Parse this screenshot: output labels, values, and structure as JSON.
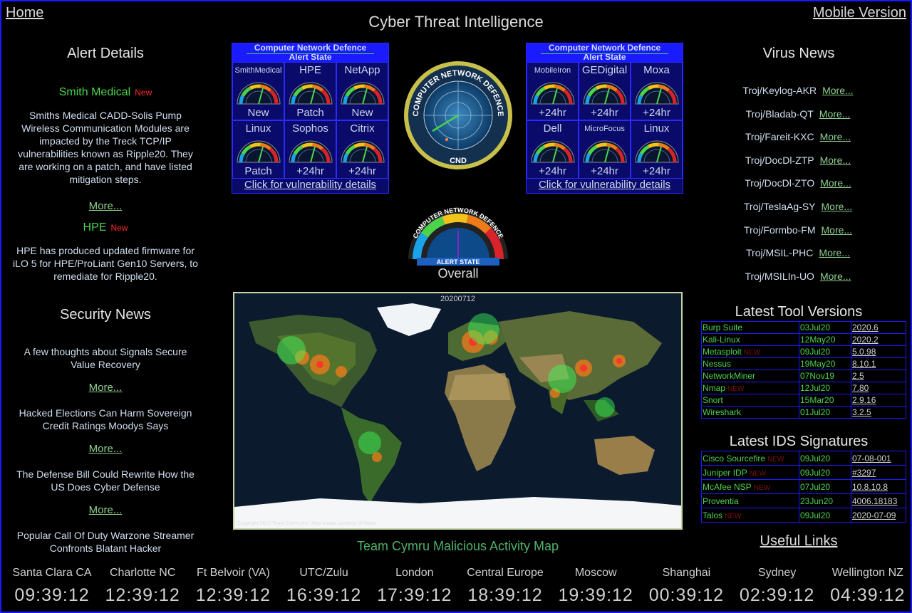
{
  "nav": {
    "home": "Home",
    "mobile": "Mobile Version"
  },
  "page_title": "Cyber Threat Intelligence",
  "alert_details": {
    "heading": "Alert Details",
    "alerts": [
      {
        "title": "Smith Medical",
        "new": "New",
        "text": "Smiths Medical CADD-Solis Pump Wireless Communication Modules are impacted by the Treck TCP/IP vulnerabilities known as Ripple20. They are working on a patch, and have listed mitigation steps.",
        "more": "More..."
      },
      {
        "title": "HPE",
        "new": "New",
        "text": "HPE has produced updated firmware for iLO 5 for HPE/ProLiant Gen10 Servers, to remediate for Ripple20.",
        "more": ""
      }
    ]
  },
  "security_news": {
    "heading": "Security News",
    "items": [
      {
        "text": "A few thoughts about Signals Secure Value Recovery",
        "more": "More..."
      },
      {
        "text": "Hacked Elections Can Harm Sovereign Credit Ratings Moodys Says",
        "more": "More..."
      },
      {
        "text": "The Defense Bill Could Rewrite How the US Does Cyber Defense",
        "more": "More..."
      },
      {
        "text": "Popular Call Of Duty Warzone Streamer Confronts Blatant Hacker",
        "more": ""
      }
    ]
  },
  "cnd_panels": [
    {
      "header": "Computer Network Defence",
      "subheader": "Alert State",
      "link": "Click for vulnerability details",
      "vendors": [
        {
          "name": "SmithMedical",
          "status": "New"
        },
        {
          "name": "HPE",
          "status": "Patch"
        },
        {
          "name": "NetApp",
          "status": "New"
        },
        {
          "name": "Linux",
          "status": "Patch"
        },
        {
          "name": "Sophos",
          "status": "+24hr"
        },
        {
          "name": "Citrix",
          "status": "+24hr"
        }
      ]
    },
    {
      "header": "Computer Network Defence",
      "subheader": "Alert State",
      "link": "Click for vulnerability details",
      "vendors": [
        {
          "name": "MobileIron",
          "status": "+24hr"
        },
        {
          "name": "GEDigital",
          "status": "+24hr"
        },
        {
          "name": "Moxa",
          "status": "+24hr"
        },
        {
          "name": "Dell",
          "status": "+24hr"
        },
        {
          "name": "MicroFocus",
          "status": "+24hr"
        },
        {
          "name": "Linux",
          "status": "+24hr"
        }
      ]
    }
  ],
  "cnd_logo": {
    "ring_top": "COMPUTER NETWORK DEFENCE",
    "bottom": "CND"
  },
  "overall": {
    "arc_text": "COMPUTER NETWORK DEFENCE",
    "badge": "ALERT STATE",
    "label": "Overall"
  },
  "map": {
    "date": "20200712",
    "copyright": "Copyright 2017 Team Cymru,Inc. Map image courtesy of Nasa.",
    "caption": "Team Cymru Malicious Activity Map"
  },
  "virus_news": {
    "heading": "Virus News",
    "items": [
      {
        "name": "Troj/Keylog-AKR",
        "more": "More..."
      },
      {
        "name": "Troj/Bladab-QT",
        "more": "More..."
      },
      {
        "name": "Troj/Fareit-KXC",
        "more": "More..."
      },
      {
        "name": "Troj/DocDl-ZTP",
        "more": "More..."
      },
      {
        "name": "Troj/DocDl-ZTO",
        "more": "More..."
      },
      {
        "name": "Troj/TeslaAg-SY",
        "more": "More..."
      },
      {
        "name": "Troj/Formbo-FM",
        "more": "More..."
      },
      {
        "name": "Troj/MSIL-PHC",
        "more": "More..."
      },
      {
        "name": "Troj/MSILIn-UO",
        "more": "More..."
      }
    ]
  },
  "tool_versions": {
    "heading": "Latest Tool Versions",
    "rows": [
      {
        "tool": "Burp Suite",
        "new": "",
        "date": "03Jul20",
        "version": "2020.6"
      },
      {
        "tool": "Kali-Linux",
        "new": "",
        "date": "12May20",
        "version": "2020.2"
      },
      {
        "tool": "Metasploit",
        "new": "NEW",
        "date": "09Jul20",
        "version": "5.0.98"
      },
      {
        "tool": "Nessus",
        "new": "",
        "date": "19May20",
        "version": "8.10.1"
      },
      {
        "tool": "NetworkMiner",
        "new": "",
        "date": "07Nov19",
        "version": "2.5"
      },
      {
        "tool": "Nmap",
        "new": "NEW",
        "date": "12Jul20",
        "version": "7.80"
      },
      {
        "tool": "Snort",
        "new": "",
        "date": "15Mar20",
        "version": "2.9.16"
      },
      {
        "tool": "Wireshark",
        "new": "",
        "date": "01Jul20",
        "version": "3.2.5"
      }
    ]
  },
  "ids_signatures": {
    "heading": "Latest IDS Signatures",
    "rows": [
      {
        "vendor": "Cisco Sourcefire",
        "new": "NEW",
        "date": "09Jul20",
        "sig": "07-08-001"
      },
      {
        "vendor": "Juniper IDP",
        "new": "NEW",
        "date": "09Jul20",
        "sig": "#3297"
      },
      {
        "vendor": "McAfee NSP",
        "new": "NEW",
        "date": "07Jul20",
        "sig": "10.8.10.8"
      },
      {
        "vendor": "Proventia",
        "new": "",
        "date": "23Jun20",
        "sig": "4006.18183"
      },
      {
        "vendor": "Talos",
        "new": "NEW",
        "date": "09Jul20",
        "sig": "2020-07-09"
      }
    ]
  },
  "useful_links": "Useful Links",
  "clocks": [
    {
      "city": "Santa Clara CA",
      "time": "09:39:12"
    },
    {
      "city": "Charlotte NC",
      "time": "12:39:12"
    },
    {
      "city": "Ft Belvoir (VA)",
      "time": "12:39:12"
    },
    {
      "city": "UTC/Zulu",
      "time": "16:39:12"
    },
    {
      "city": "London",
      "time": "17:39:12"
    },
    {
      "city": "Central Europe",
      "time": "18:39:12"
    },
    {
      "city": "Moscow",
      "time": "19:39:12"
    },
    {
      "city": "Shanghai",
      "time": "00:39:12"
    },
    {
      "city": "Sydney",
      "time": "02:39:12"
    },
    {
      "city": "Wellington NZ",
      "time": "04:39:12"
    }
  ],
  "colors": {
    "accent_green": "#4cd34c",
    "new_red": "#ff2b2b",
    "panel_blue": "#1b1bff",
    "border_blue": "#1a1aff"
  }
}
